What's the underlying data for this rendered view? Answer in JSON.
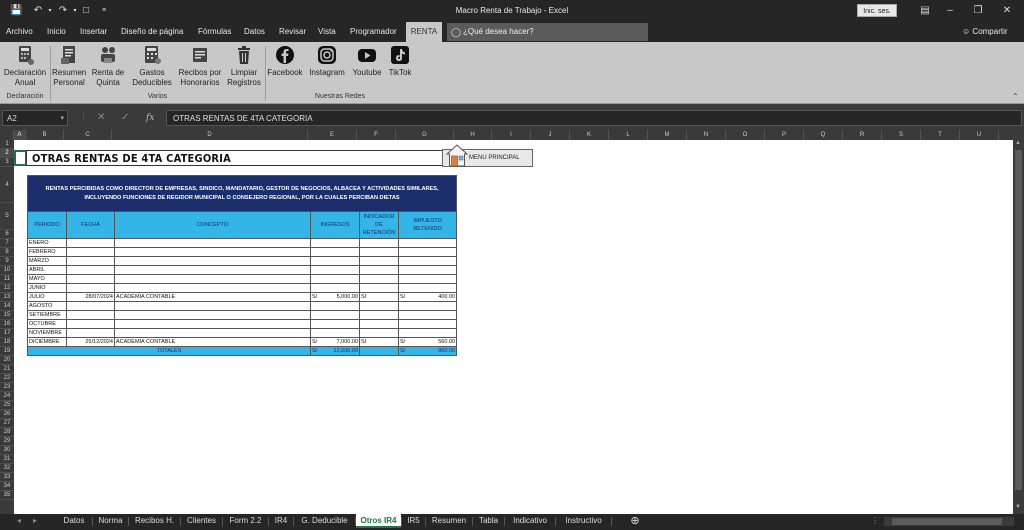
{
  "window": {
    "title": "Macro Renta de Trabajo  -  Excel",
    "signin": "Inic. ses."
  },
  "menu": {
    "tabs": [
      "Archivo",
      "Inicio",
      "Insertar",
      "Diseño de página",
      "Fórmulas",
      "Datos",
      "Revisar",
      "Vista",
      "Programador",
      "RENTA"
    ],
    "tellme": "¿Qué desea hacer?",
    "share": "Compartir"
  },
  "ribbon": {
    "declaracion": {
      "label": "Declaración",
      "btn1": "Declaración Anual"
    },
    "varios": {
      "label": "Varios",
      "btn1": "Resumen Personal",
      "btn2": "Renta de Quinta",
      "btn3": "Gastos Deducibles",
      "btn4": "Recibos por Honorarios",
      "btn5": "Limpiar Registros"
    },
    "redes": {
      "label": "Nuestras Redes",
      "btn1": "Facebook",
      "btn2": "Instagram",
      "btn3": "Youtube",
      "btn4": "TikTok"
    }
  },
  "formulabar": {
    "namebox": "A2",
    "fx": "fx",
    "formula": "OTRAS RENTAS DE 4TA CATEGORIA"
  },
  "columns": [
    "A",
    "B",
    "C",
    "D",
    "E",
    "F",
    "G",
    "H",
    "I",
    "J",
    "K",
    "L",
    "M",
    "N",
    "O",
    "P",
    "Q",
    "R",
    "S",
    "T",
    "U"
  ],
  "rows": [
    "1",
    "2",
    "3",
    "4",
    "5",
    "6",
    "7",
    "8",
    "9",
    "10",
    "11",
    "12",
    "13",
    "14",
    "15",
    "16",
    "17",
    "18",
    "19",
    "20",
    "21",
    "22",
    "23",
    "24",
    "25",
    "26",
    "27",
    "28",
    "29",
    "30",
    "31",
    "32",
    "33",
    "34",
    "35"
  ],
  "sheet": {
    "title": "OTRAS RENTAS DE 4TA CATEGORIA",
    "menu_button": "MENU PRINCIPAL",
    "banner": "RENTAS PERCIBIDAS COMO DIRECTOR DE EMPRESAS, SINDICO, MANDATARIO, GESTOR DE NEGOCIOS, ALBACEA Y ACTIVIDADES SIMILARES, INCLUYENDO FUNCIONES DE REGIDOR MUNICIPAL O CONSEJERO REGIONAL, POR LA CUALES PERCIBAN DIETAS",
    "headers": {
      "periodo": "PERIODO",
      "fecha": "FECHA",
      "concepto": "CONCEPTO",
      "ingresos": "INGRESOS",
      "indicador": "INDICADOR DE RETENCIÓN",
      "impuesto": "IMPUESTO RETENIDO"
    },
    "months": [
      {
        "mes": "ENERO",
        "fecha": "",
        "concepto": "",
        "cur1": "",
        "ingreso": "",
        "ind": "",
        "cur2": "",
        "imp": ""
      },
      {
        "mes": "FEBRERO",
        "fecha": "",
        "concepto": "",
        "cur1": "",
        "ingreso": "",
        "ind": "",
        "cur2": "",
        "imp": ""
      },
      {
        "mes": "MARZO",
        "fecha": "",
        "concepto": "",
        "cur1": "",
        "ingreso": "",
        "ind": "",
        "cur2": "",
        "imp": ""
      },
      {
        "mes": "ABRIL",
        "fecha": "",
        "concepto": "",
        "cur1": "",
        "ingreso": "",
        "ind": "",
        "cur2": "",
        "imp": ""
      },
      {
        "mes": "MAYO",
        "fecha": "",
        "concepto": "",
        "cur1": "",
        "ingreso": "",
        "ind": "",
        "cur2": "",
        "imp": ""
      },
      {
        "mes": "JUNIO",
        "fecha": "",
        "concepto": "",
        "cur1": "",
        "ingreso": "",
        "ind": "",
        "cur2": "",
        "imp": ""
      },
      {
        "mes": "JULIO",
        "fecha": "28/07/2024",
        "concepto": "ACADEMIA CONTABLE",
        "cur1": "S/",
        "ingreso": "5,000.00",
        "ind": "SI",
        "cur2": "S/",
        "imp": "400.00"
      },
      {
        "mes": "AGOSTO",
        "fecha": "",
        "concepto": "",
        "cur1": "",
        "ingreso": "",
        "ind": "",
        "cur2": "",
        "imp": ""
      },
      {
        "mes": "SETIEMBRE",
        "fecha": "",
        "concepto": "",
        "cur1": "",
        "ingreso": "",
        "ind": "",
        "cur2": "",
        "imp": ""
      },
      {
        "mes": "OCTUBRE",
        "fecha": "",
        "concepto": "",
        "cur1": "",
        "ingreso": "",
        "ind": "",
        "cur2": "",
        "imp": ""
      },
      {
        "mes": "NOVIEMBRE",
        "fecha": "",
        "concepto": "",
        "cur1": "",
        "ingreso": "",
        "ind": "",
        "cur2": "",
        "imp": ""
      },
      {
        "mes": "DICIEMBRE",
        "fecha": "25/12/2024",
        "concepto": "ACADEMIA CONTABLE",
        "cur1": "S/",
        "ingreso": "7,000.00",
        "ind": "SI",
        "cur2": "S/",
        "imp": "560.00"
      }
    ],
    "totals": {
      "label": "TOTALES",
      "cur1": "S/",
      "ingresos": "12,000.00",
      "cur2": "S/",
      "impuesto": "960.00"
    }
  },
  "sheettabs": [
    "Datos",
    "Norma",
    "Recibos H.",
    "Clientes",
    "Form 2.2",
    "IR4",
    "G. Deducible",
    "Otros IR4",
    "IR5",
    "Resumen",
    "Tabla",
    "Indicativo",
    "Instructivo"
  ],
  "active_tab": "Otros IR4",
  "colors": {
    "accent": "#217346",
    "banner": "#1a2e6b",
    "header": "#33b5e8"
  }
}
